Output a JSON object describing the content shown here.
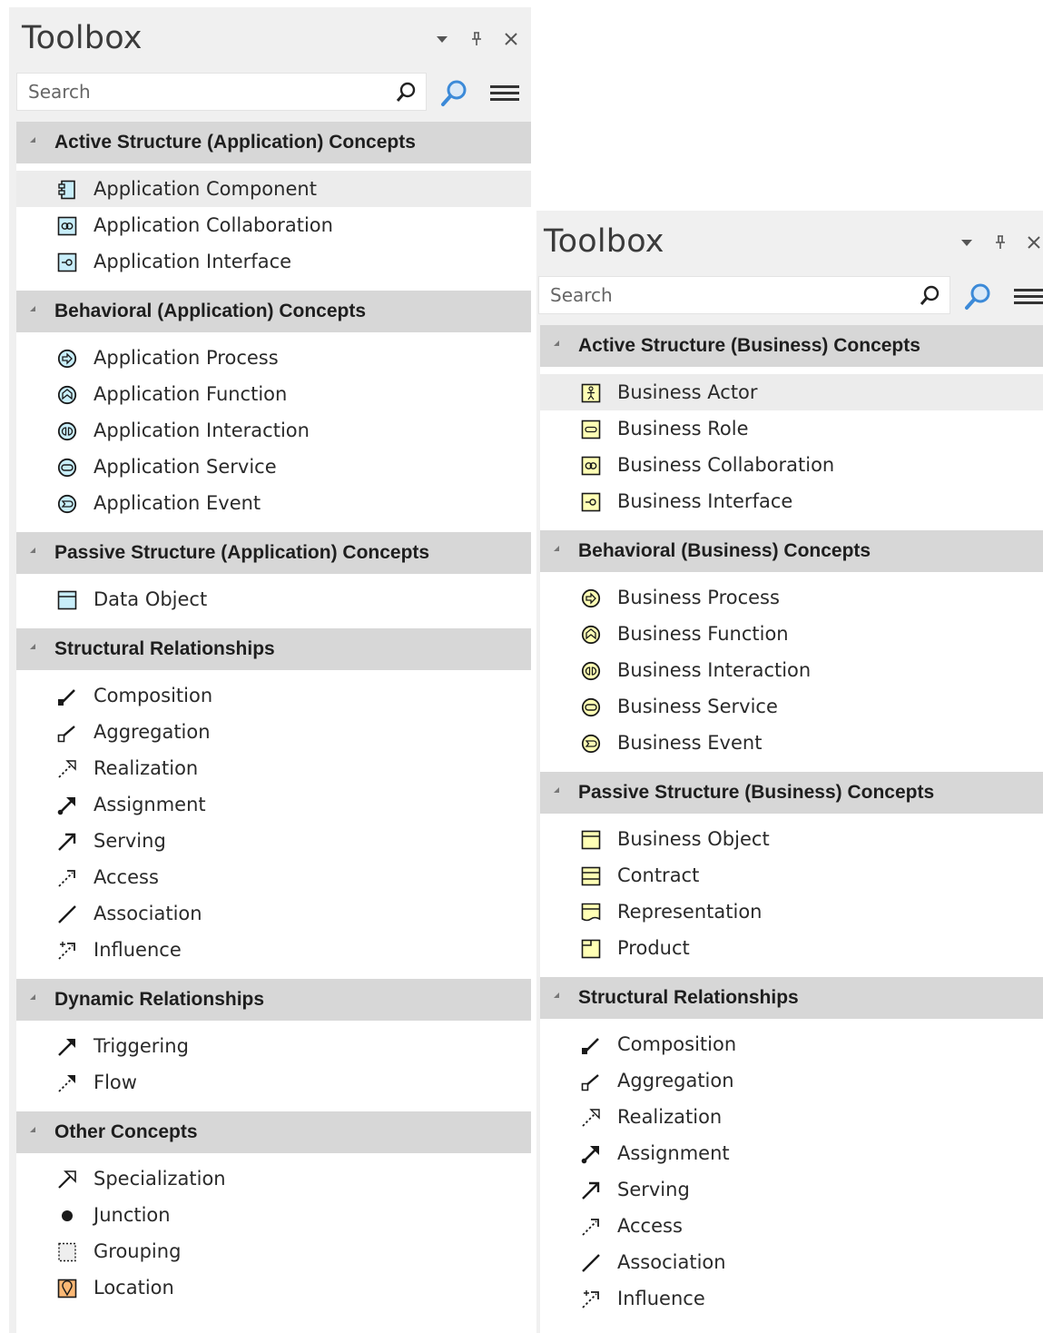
{
  "left": {
    "title": "Toolbox",
    "search_placeholder": "Search",
    "controls": {
      "dropdown": "▾",
      "pin": "⊥",
      "close": "×"
    },
    "groups": [
      {
        "label": "Active Structure (Application) Concepts",
        "items": [
          {
            "label": "Application Component",
            "icon": "component-icon",
            "selected": true
          },
          {
            "label": "Application Collaboration",
            "icon": "collaboration-icon"
          },
          {
            "label": "Application Interface",
            "icon": "interface-icon"
          }
        ]
      },
      {
        "label": "Behavioral (Application) Concepts",
        "items": [
          {
            "label": "Application Process",
            "icon": "process-icon"
          },
          {
            "label": "Application Function",
            "icon": "function-icon"
          },
          {
            "label": "Application Interaction",
            "icon": "interaction-icon"
          },
          {
            "label": "Application Service",
            "icon": "service-icon"
          },
          {
            "label": "Application Event",
            "icon": "event-icon"
          }
        ]
      },
      {
        "label": "Passive Structure (Application) Concepts",
        "items": [
          {
            "label": "Data Object",
            "icon": "object-icon"
          }
        ]
      },
      {
        "label": "Structural Relationships",
        "items": [
          {
            "label": "Composition",
            "icon": "composition-icon"
          },
          {
            "label": "Aggregation",
            "icon": "aggregation-icon"
          },
          {
            "label": "Realization",
            "icon": "realization-icon"
          },
          {
            "label": "Assignment",
            "icon": "assignment-icon"
          },
          {
            "label": "Serving",
            "icon": "serving-icon"
          },
          {
            "label": "Access",
            "icon": "access-icon"
          },
          {
            "label": "Association",
            "icon": "association-icon"
          },
          {
            "label": "Influence",
            "icon": "influence-icon"
          }
        ]
      },
      {
        "label": "Dynamic Relationships",
        "items": [
          {
            "label": "Triggering",
            "icon": "triggering-icon"
          },
          {
            "label": "Flow",
            "icon": "flow-icon"
          }
        ]
      },
      {
        "label": "Other Concepts",
        "items": [
          {
            "label": "Specialization",
            "icon": "specialization-icon"
          },
          {
            "label": "Junction",
            "icon": "junction-icon"
          },
          {
            "label": "Grouping",
            "icon": "grouping-icon"
          },
          {
            "label": "Location",
            "icon": "location-icon"
          }
        ]
      }
    ]
  },
  "right": {
    "title": "Toolbox",
    "search_placeholder": "Search",
    "controls": {
      "dropdown": "▾",
      "pin": "⊥",
      "close": "×"
    },
    "groups": [
      {
        "label": "Active Structure (Business) Concepts",
        "items": [
          {
            "label": "Business Actor",
            "icon": "actor-icon",
            "selected": true
          },
          {
            "label": "Business Role",
            "icon": "role-icon"
          },
          {
            "label": "Business Collaboration",
            "icon": "collaboration-icon"
          },
          {
            "label": "Business Interface",
            "icon": "interface-icon"
          }
        ]
      },
      {
        "label": "Behavioral (Business) Concepts",
        "items": [
          {
            "label": "Business Process",
            "icon": "process-icon"
          },
          {
            "label": "Business Function",
            "icon": "function-icon"
          },
          {
            "label": "Business Interaction",
            "icon": "interaction-icon"
          },
          {
            "label": "Business Service",
            "icon": "service-icon"
          },
          {
            "label": "Business Event",
            "icon": "event-icon"
          }
        ]
      },
      {
        "label": "Passive Structure (Business) Concepts",
        "items": [
          {
            "label": "Business Object",
            "icon": "object-icon"
          },
          {
            "label": "Contract",
            "icon": "contract-icon"
          },
          {
            "label": "Representation",
            "icon": "representation-icon"
          },
          {
            "label": "Product",
            "icon": "product-icon"
          }
        ]
      },
      {
        "label": "Structural Relationships",
        "items": [
          {
            "label": "Composition",
            "icon": "composition-icon"
          },
          {
            "label": "Aggregation",
            "icon": "aggregation-icon"
          },
          {
            "label": "Realization",
            "icon": "realization-icon"
          },
          {
            "label": "Assignment",
            "icon": "assignment-icon"
          },
          {
            "label": "Serving",
            "icon": "serving-icon"
          },
          {
            "label": "Access",
            "icon": "access-icon"
          },
          {
            "label": "Association",
            "icon": "association-icon"
          },
          {
            "label": "Influence",
            "icon": "influence-icon"
          }
        ]
      }
    ]
  },
  "colors": {
    "app_fill": "#c8eefa",
    "business_fill": "#ffffb5",
    "location_fill": "#fbb875",
    "header_bg": "#d7d7d7",
    "selected_bg": "#ececec",
    "find_blue": "#3c8ad8"
  }
}
